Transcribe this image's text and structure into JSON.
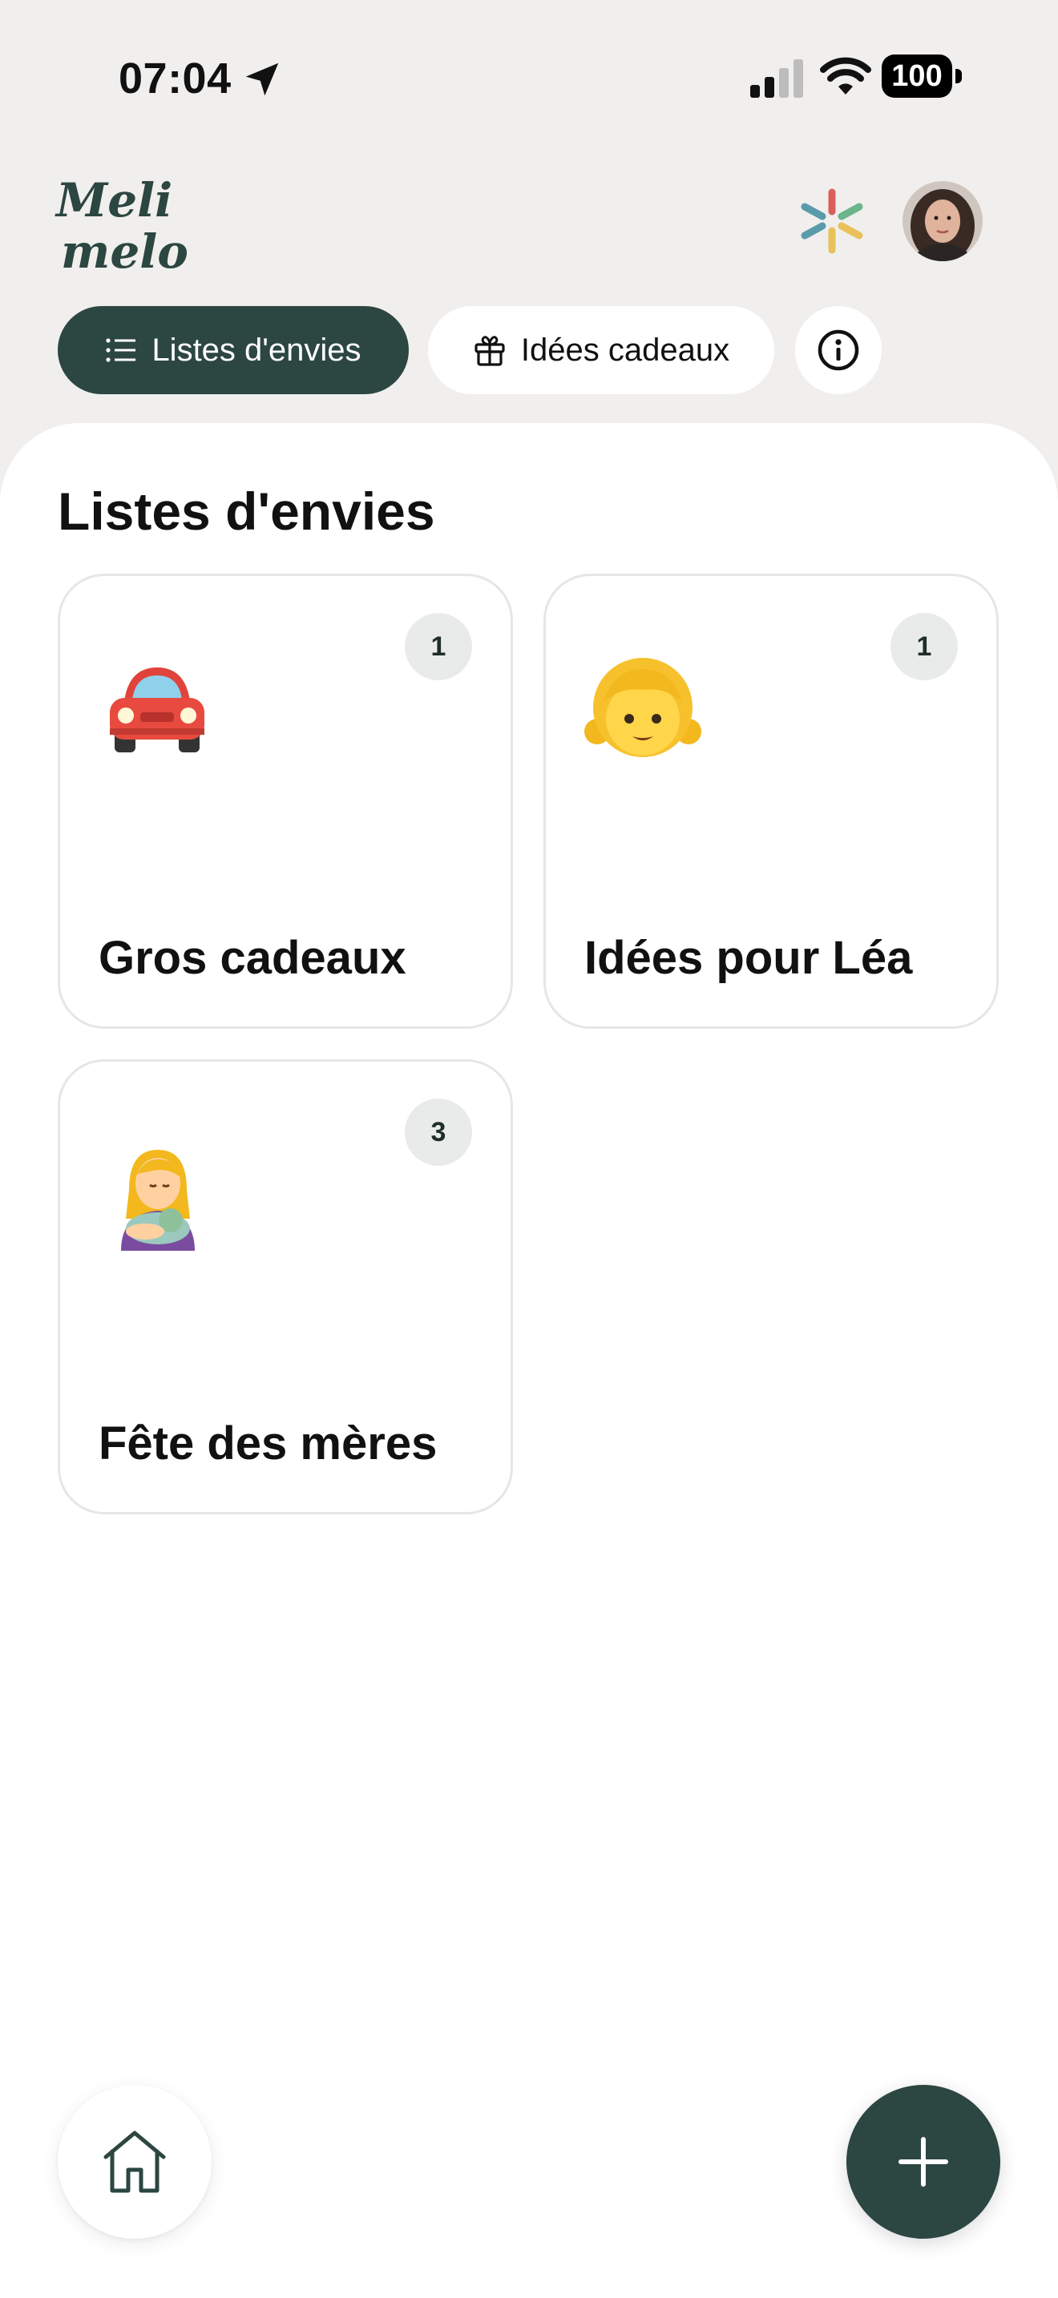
{
  "status_bar": {
    "time": "07:04",
    "battery": "100",
    "icons": [
      "location-arrow-icon",
      "cellular-signal-icon",
      "wifi-icon",
      "battery-icon"
    ]
  },
  "header": {
    "logo_line1": "Meli",
    "logo_line2": "melo",
    "sparkle_icon": "sparkle-icon",
    "avatar": "user-avatar",
    "brand_color": "#2c4641"
  },
  "tabs": [
    {
      "label": "Listes d'envies",
      "icon": "list-icon",
      "active": true
    },
    {
      "label": "Idées cadeaux",
      "icon": "gift-icon",
      "active": false
    },
    {
      "icon": "info-icon"
    }
  ],
  "main": {
    "title": "Listes d'envies",
    "cards": [
      {
        "title": "Gros cadeaux",
        "count": "1",
        "emoji": "car-emoji"
      },
      {
        "title": "Idées pour Léa",
        "count": "1",
        "emoji": "girl-emoji"
      },
      {
        "title": "Fête des mères",
        "count": "3",
        "emoji": "breastfeeding-woman-emoji"
      }
    ]
  },
  "bottom": {
    "home_icon": "home-icon",
    "add_icon": "plus-icon"
  }
}
